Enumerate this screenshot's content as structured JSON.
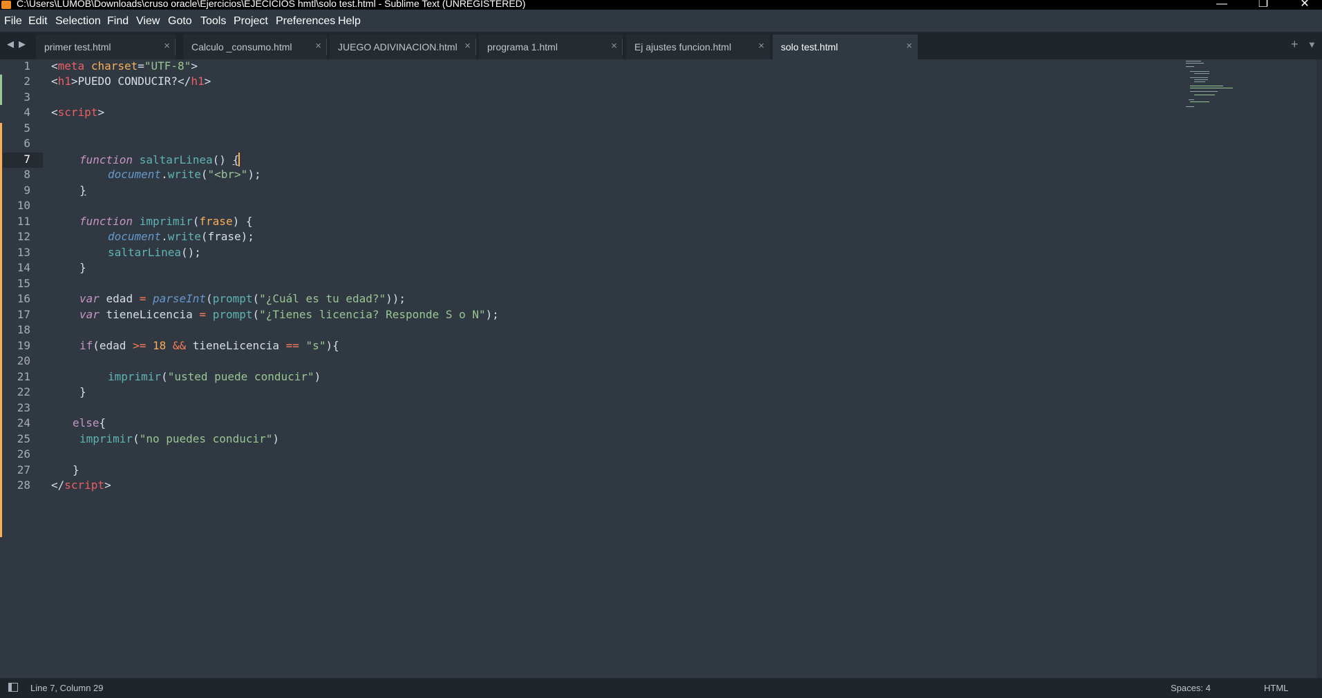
{
  "window": {
    "title": "C:\\Users\\LUMOB\\Downloads\\cruso oracle\\Ejercicios\\EJECICIOS hmtl\\solo test.html - Sublime Text (UNREGISTERED)",
    "minimize": "—",
    "restore": "❐",
    "close": "✕"
  },
  "menu": [
    "File",
    "Edit",
    "Selection",
    "Find",
    "View",
    "Goto",
    "Tools",
    "Project",
    "Preferences",
    "Help"
  ],
  "tabs": [
    {
      "label": "primer test.html"
    },
    {
      "label": "Calculo _consumo.html"
    },
    {
      "label": "JUEGO ADIVINACION.html"
    },
    {
      "label": "programa 1.html"
    },
    {
      "label": "Ej ajustes funcion.html"
    },
    {
      "label": "solo test.html"
    }
  ],
  "tab_close": "×",
  "tabbar": {
    "back": "◀",
    "forward": "▶",
    "new_tab": "+",
    "more": "▼"
  },
  "editor": {
    "current_line": 7,
    "line_numbers": [
      "1",
      "2",
      "3",
      "4",
      "5",
      "6",
      "7",
      "8",
      "9",
      "10",
      "11",
      "12",
      "13",
      "14",
      "15",
      "16",
      "17",
      "18",
      "19",
      "20",
      "21",
      "22",
      "23",
      "24",
      "25",
      "26",
      "27",
      "28"
    ],
    "code": {
      "l1_open": "<",
      "l1_meta": "meta",
      "l1_attr": "charset",
      "l1_eq": "=",
      "l1_val": "\"UTF-8\"",
      "l1_close": ">",
      "l2_open": "<",
      "l2_h1": "h1",
      "l2_gt": ">",
      "l2_text": "PUEDO CONDUCIR?",
      "l2_end": "</",
      "l2_h1b": "h1",
      "l2_gt2": ">",
      "l4_open": "<",
      "l4_script": "script",
      "l4_gt": ">",
      "l7_kw": "function",
      "l7_fn": "saltarLinea",
      "l7_rest": "() ",
      "l7_brace": "{",
      "l8_obj": "document",
      "l8_dot": ".",
      "l8_fn": "write",
      "l8_p1": "(",
      "l8_str": "\"<br>\"",
      "l8_p2": ");",
      "l9_brace": "}",
      "l11_kw": "function",
      "l11_fn": "imprimir",
      "l11_p1": "(",
      "l11_prm": "frase",
      "l11_p2": ") {",
      "l12_obj": "document",
      "l12_dot": ".",
      "l12_fn": "write",
      "l12_rest": "(frase);",
      "l13_fn": "saltarLinea",
      "l13_rest": "();",
      "l14_brace": "}",
      "l16_kw": "var",
      "l16_name": " edad ",
      "l16_op": "=",
      "l16_fn": "parseInt",
      "l16_p1": "(",
      "l16_fn2": "prompt",
      "l16_p2": "(",
      "l16_str": "\"¿Cuál es tu edad?\"",
      "l16_p3": "));",
      "l17_kw": "var",
      "l17_name": " tieneLicencia ",
      "l17_op": "=",
      "l17_fn": "prompt",
      "l17_p1": "(",
      "l17_str": "\"¿Tienes licencia? Responde S o N\"",
      "l17_p2": ");",
      "l19_kw": "if",
      "l19_a": "(edad ",
      "l19_op1": ">=",
      "l19_num": "18",
      "l19_op2": "&&",
      "l19_b": " tieneLicencia ",
      "l19_op3": "==",
      "l19_str": "\"s\"",
      "l19_c": "){",
      "l21_fn": "imprimir",
      "l21_p1": "(",
      "l21_str": "\"usted puede conducir\"",
      "l21_p2": ")",
      "l22_brace": "}",
      "l24_kw": "else",
      "l24_brace": "{",
      "l25_fn": "imprimir",
      "l25_p1": "(",
      "l25_str": "\"no puedes conducir\"",
      "l25_p2": ")",
      "l27_brace": "}",
      "l28_open": "</",
      "l28_script": "script",
      "l28_gt": ">"
    }
  },
  "status": {
    "position": "Line 7, Column 29",
    "indent": "Spaces: 4",
    "syntax": "HTML"
  },
  "colors": {
    "background": "#303841",
    "tag": "#ec5f66",
    "string": "#99c794",
    "keyword": "#c695c6",
    "function": "#5fb4b4",
    "modified_marker": "#f9ae58",
    "added_marker": "#99c794"
  }
}
